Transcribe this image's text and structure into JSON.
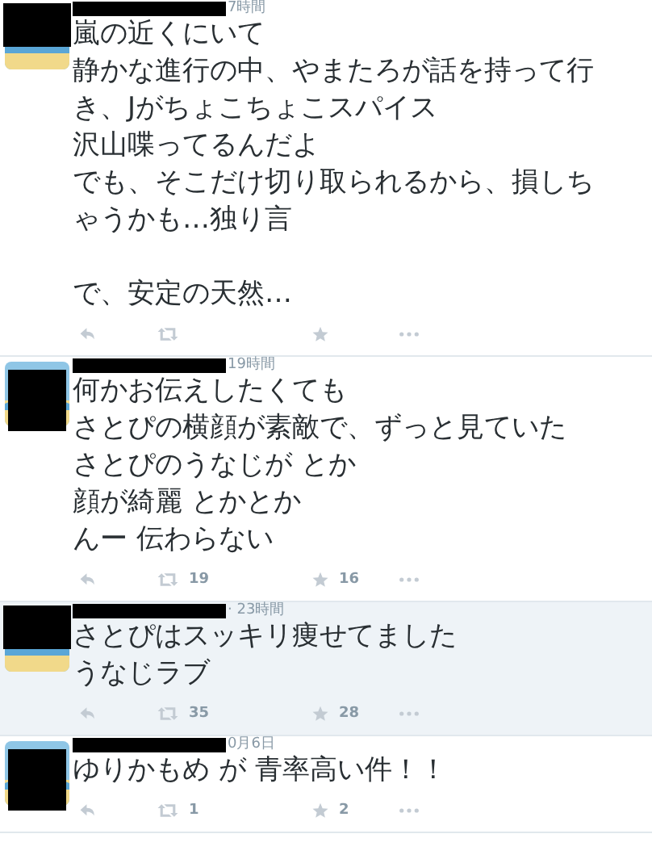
{
  "tweets": [
    {
      "time": "7時間",
      "highlighted": false,
      "lines": [
        "嵐の近くにいて",
        "静かな進行の中、やまたろが話を持って行",
        "き、Jがちょこちょこスパイス",
        "沢山喋ってるんだよ",
        "でも、そこだけ切り取られるから、損しち",
        "ゃうかも…独り言",
        "で、安定の天然…"
      ]
    },
    {
      "time": "19時間",
      "highlighted": false,
      "lines": [
        "何かお伝えしたくても",
        "さとぴの横顔が素敵で、ずっと見ていた",
        "さとぴのうなじが とか",
        "顔が綺麗 とかとか",
        "んー 伝わらない"
      ],
      "retweets": "19",
      "favorites": "16"
    },
    {
      "time": "· 23時間",
      "highlighted": true,
      "lines": [
        "さとぴはスッキリ痩せてました",
        "うなじラブ"
      ],
      "retweets": "35",
      "favorites": "28"
    },
    {
      "time": "0月6日",
      "highlighted": false,
      "lines": [
        "ゆりかもめ が 青率高い件！！"
      ],
      "retweets": "1",
      "favorites": "2"
    }
  ]
}
